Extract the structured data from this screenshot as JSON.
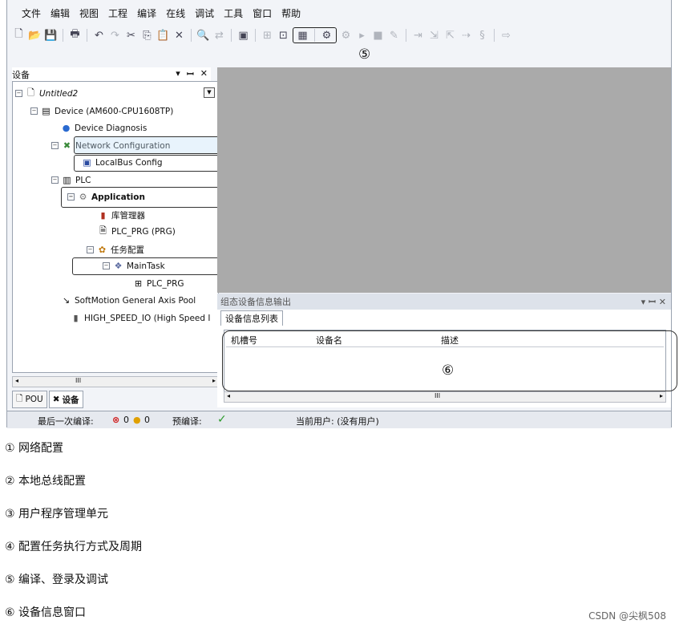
{
  "menu": [
    "文件",
    "编辑",
    "视图",
    "工程",
    "编译",
    "在线",
    "调试",
    "工具",
    "窗口",
    "帮助"
  ],
  "callouts": {
    "c1": "①",
    "c2": "②",
    "c3": "③",
    "c4": "④",
    "c5": "⑤",
    "c6": "⑥"
  },
  "panel": {
    "title": "设备",
    "pin": "▾",
    "float": "ꟷ",
    "close": "✕"
  },
  "tree": {
    "project": "Untitled2",
    "device": "Device (AM600-CPU1608TP)",
    "diagnosis": "Device Diagnosis",
    "network": "Network Configuration",
    "localbus": "LocalBus Config",
    "plc": "PLC",
    "application": "Application",
    "library": "库管理器",
    "plc_prg": "PLC_PRG (PRG)",
    "task_config": "任务配置",
    "maintask": "MainTask",
    "maintask_prg": "PLC_PRG",
    "softmotion": "SoftMotion General Axis Pool",
    "highspeed": "HIGH_SPEED_IO (High Speed I"
  },
  "scroll_marker": "III",
  "bottom_tabs": {
    "pou": "POU",
    "devices": "设备"
  },
  "output": {
    "title": "组态设备信息输出",
    "tab": "设备信息列表",
    "columns": [
      "机槽号",
      "设备名",
      "描述"
    ],
    "buttons": "▾  ꟷ  ✕"
  },
  "status": {
    "last_compile_label": "最后一次编译:",
    "errors": "0",
    "warnings": "0",
    "precompile_label": "预编译:",
    "check": "✓",
    "user": "当前用户: (没有用户)"
  },
  "legend": [
    "① 网络配置",
    "② 本地总线配置",
    "③ 用户程序管理单元",
    "④ 配置任务执行方式及周期",
    "⑤ 编译、登录及调试",
    "⑥ 设备信息窗口"
  ],
  "watermark": "CSDN @尖枫508"
}
